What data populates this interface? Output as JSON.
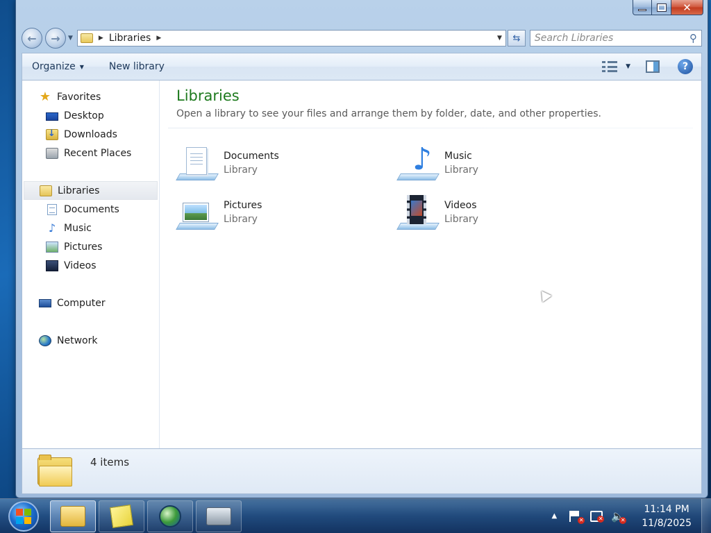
{
  "window": {
    "address": {
      "crumb": "Libraries"
    },
    "search": {
      "placeholder": "Search Libraries"
    },
    "toolbar": {
      "organize": "Organize",
      "new_library": "New library"
    },
    "nav": {
      "favorites": {
        "label": "Favorites",
        "items": [
          "Desktop",
          "Downloads",
          "Recent Places"
        ]
      },
      "libraries": {
        "label": "Libraries",
        "items": [
          "Documents",
          "Music",
          "Pictures",
          "Videos"
        ]
      },
      "computer": "Computer",
      "network": "Network"
    },
    "content": {
      "title": "Libraries",
      "subtitle": "Open a library to see your files and arrange them by folder, date, and other properties.",
      "libraries": [
        {
          "name": "Documents",
          "type": "Library",
          "icon": "documents-library-icon"
        },
        {
          "name": "Music",
          "type": "Library",
          "icon": "music-library-icon"
        },
        {
          "name": "Pictures",
          "type": "Library",
          "icon": "pictures-library-icon"
        },
        {
          "name": "Videos",
          "type": "Library",
          "icon": "videos-library-icon"
        }
      ]
    },
    "details": {
      "count": "4 items"
    }
  },
  "taskbar": {
    "pinned": [
      "windows-explorer-icon",
      "sticky-notes-icon",
      "browser-icon",
      "fax-scan-icon"
    ],
    "clock": {
      "time": "11:14 PM",
      "date": "11/8/2025"
    }
  },
  "colors": {
    "title_green": "#1e7a1e",
    "selected_nav_bg": "#e4e8ee",
    "close_red": "#c23b1f"
  }
}
